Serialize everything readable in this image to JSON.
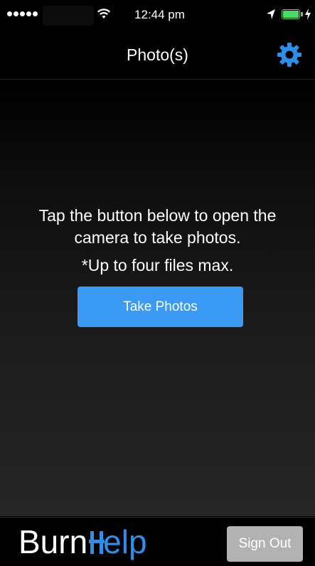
{
  "status_bar": {
    "time": "12:44 pm",
    "signal_bars": 5,
    "battery_color": "#4cd964"
  },
  "nav": {
    "title": "Photo(s)",
    "settings_icon": "gear-icon",
    "accent_color": "#2f8fe8"
  },
  "main": {
    "instructions": "Tap the button below to open the camera to take photos.",
    "limit_note": "*Up to four files max.",
    "take_photos_label": "Take Photos",
    "button_color": "#3b9bf4"
  },
  "footer": {
    "logo_text_left": "Burn",
    "logo_text_right": "elp",
    "sign_out_label": "Sign Out",
    "sign_out_color": "#b2b2b2"
  }
}
